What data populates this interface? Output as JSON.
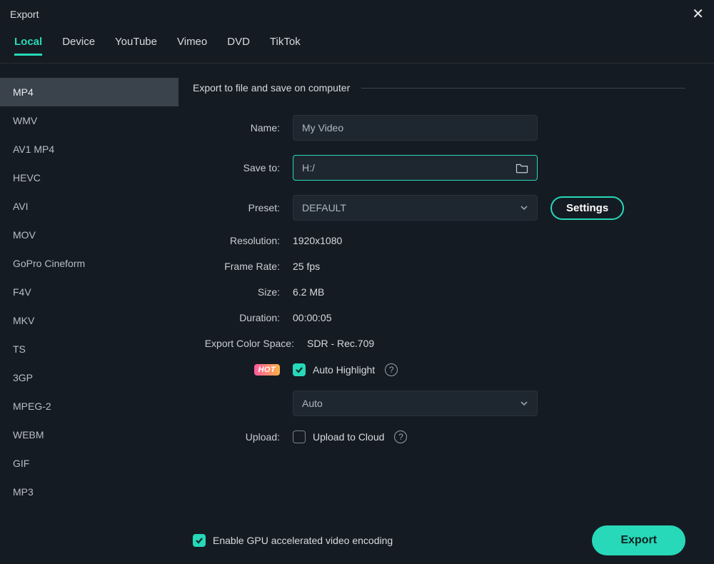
{
  "window": {
    "title": "Export"
  },
  "tabs": [
    {
      "label": "Local",
      "active": true
    },
    {
      "label": "Device"
    },
    {
      "label": "YouTube"
    },
    {
      "label": "Vimeo"
    },
    {
      "label": "DVD"
    },
    {
      "label": "TikTok"
    }
  ],
  "formats": [
    "MP4",
    "WMV",
    "AV1 MP4",
    "HEVC",
    "AVI",
    "MOV",
    "GoPro Cineform",
    "F4V",
    "MKV",
    "TS",
    "3GP",
    "MPEG-2",
    "WEBM",
    "GIF",
    "MP3"
  ],
  "selected_format_index": 0,
  "section": {
    "heading": "Export to file and save on computer"
  },
  "form": {
    "name_label": "Name:",
    "name_value": "My Video",
    "save_label": "Save to:",
    "save_value": "H:/",
    "preset_label": "Preset:",
    "preset_value": "DEFAULT",
    "settings_btn": "Settings",
    "resolution_label": "Resolution:",
    "resolution_value": "1920x1080",
    "framerate_label": "Frame Rate:",
    "framerate_value": "25 fps",
    "size_label": "Size:",
    "size_value": "6.2 MB",
    "duration_label": "Duration:",
    "duration_value": "00:00:05",
    "colorspace_label": "Export Color Space:",
    "colorspace_value": "SDR - Rec.709",
    "hot_badge": "HOT",
    "auto_highlight_label": "Auto Highlight",
    "auto_highlight_checked": true,
    "auto_highlight_select_value": "Auto",
    "upload_label": "Upload:",
    "upload_cloud_label": "Upload to Cloud",
    "upload_cloud_checked": false
  },
  "footer": {
    "gpu_label": "Enable GPU accelerated video encoding",
    "gpu_checked": true,
    "export_btn": "Export"
  }
}
